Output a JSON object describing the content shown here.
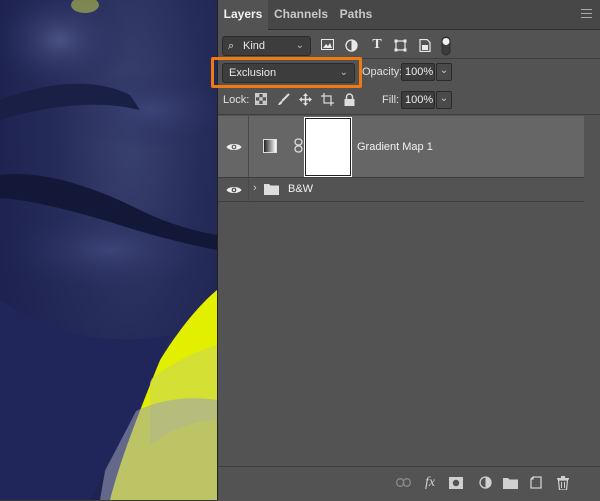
{
  "tabs": [
    {
      "label": "Layers"
    },
    {
      "label": "Channels"
    },
    {
      "label": "Paths"
    }
  ],
  "filter": {
    "kind_label": "Kind",
    "icons": [
      "image-filter-icon",
      "adjustment-filter-icon",
      "type-filter-icon",
      "shape-filter-icon",
      "smart-object-filter-icon",
      "filter-toggle-icon"
    ]
  },
  "blend": {
    "mode": "Exclusion",
    "opacity_label": "Opacity:",
    "opacity_value": "100%"
  },
  "lock": {
    "label": "Lock:",
    "fill_label": "Fill:",
    "fill_value": "100%"
  },
  "layers": [
    {
      "name": "Gradient Map 1",
      "type": "adjustment",
      "visible": true,
      "selected": true
    },
    {
      "name": "B&W",
      "type": "group",
      "visible": true,
      "selected": false
    }
  ],
  "colors": {
    "accent_highlight": "#f07a12",
    "panel_bg": "#535353",
    "selected_layer": "#666666",
    "canvas_navy": "#262c5a",
    "canvas_yellow": "#e2f000"
  }
}
